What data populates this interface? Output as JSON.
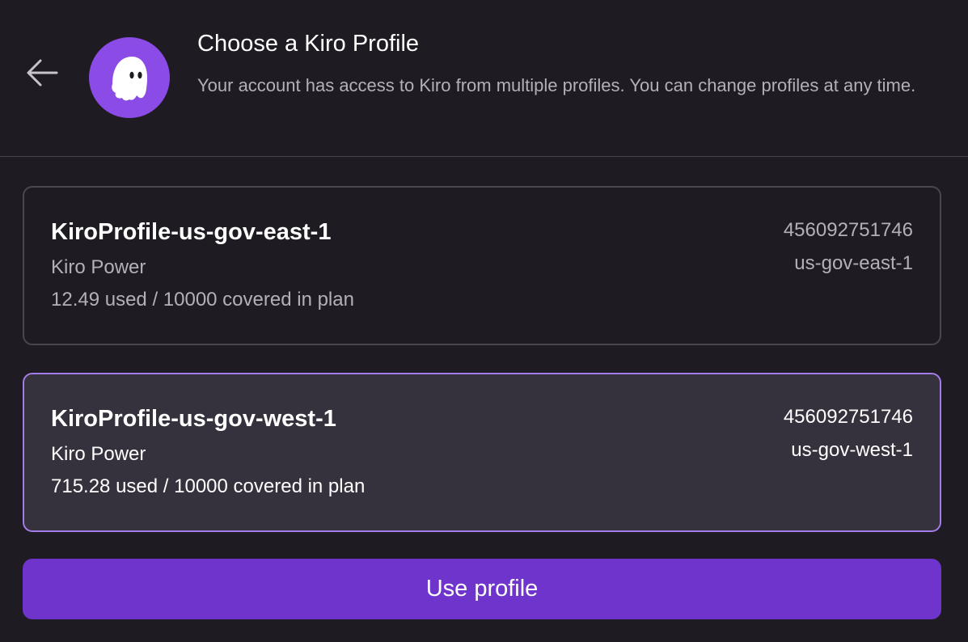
{
  "header": {
    "back_icon": "arrow-left-icon",
    "logo_icon": "ghost-icon",
    "title": "Choose a Kiro Profile",
    "subtitle": "Your account has access to Kiro from multiple profiles. You can change profiles at any time."
  },
  "profiles": [
    {
      "name": "KiroProfile-us-gov-east-1",
      "plan": "Kiro Power",
      "usage": "12.49 used / 10000 covered in plan",
      "account_id": "456092751746",
      "region": "us-gov-east-1",
      "selected": false
    },
    {
      "name": "KiroProfile-us-gov-west-1",
      "plan": "Kiro Power",
      "usage": "715.28 used / 10000 covered in plan",
      "account_id": "456092751746",
      "region": "us-gov-west-1",
      "selected": true
    }
  ],
  "actions": {
    "use_profile_label": "Use profile"
  },
  "colors": {
    "background": "#1e1b22",
    "accent": "#6e34cc",
    "logo": "#8b4be6",
    "selected_border": "#a27ce8",
    "selected_background": "#36323d"
  }
}
